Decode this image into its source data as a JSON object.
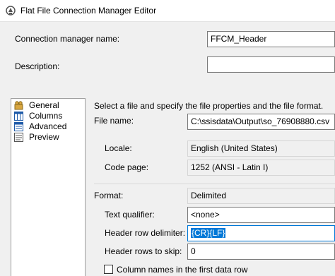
{
  "window": {
    "title": "Flat File Connection Manager Editor"
  },
  "connection": {
    "name_label": "Connection manager name:",
    "name_value": "FFCM_Header",
    "description_label": "Description:",
    "description_value": ""
  },
  "nav": {
    "items": [
      {
        "label": "General",
        "icon": "general-icon"
      },
      {
        "label": "Columns",
        "icon": "columns-icon"
      },
      {
        "label": "Advanced",
        "icon": "advanced-icon"
      },
      {
        "label": "Preview",
        "icon": "preview-icon"
      }
    ]
  },
  "general": {
    "instruction": "Select a file and specify the file properties and the file format.",
    "file_name_label": "File name:",
    "file_name_value": "C:\\ssisdata\\Output\\so_76908880.csv",
    "locale_label": "Locale:",
    "locale_value": "English (United States)",
    "code_page_label": "Code page:",
    "code_page_value": "1252  (ANSI - Latin I)",
    "format_label": "Format:",
    "format_value": "Delimited",
    "text_qualifier_label": "Text qualifier:",
    "text_qualifier_value": "<none>",
    "header_row_delimiter_label": "Header row delimiter:",
    "header_row_delimiter_value": "{CR}{LF}",
    "header_rows_to_skip_label": "Header rows to skip:",
    "header_rows_to_skip_value": "0",
    "column_names_label": "Column names in the first data row"
  },
  "colors": {
    "accent": "#0078d7",
    "background": "#f0f0f0"
  }
}
